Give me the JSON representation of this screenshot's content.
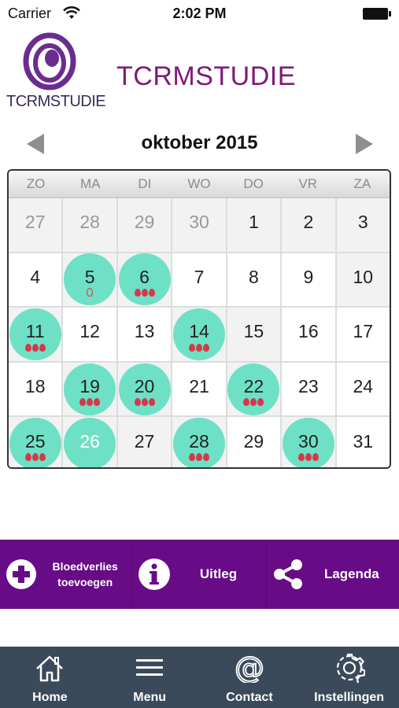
{
  "status": {
    "carrier": "Carrier",
    "time": "2:02 PM"
  },
  "header": {
    "logo_text": "TCRMSTUDIE",
    "title": "TCRMSTUDIE"
  },
  "calendar": {
    "month_label": "oktober 2015",
    "weekdays": [
      "ZO",
      "MA",
      "DI",
      "WO",
      "DO",
      "VR",
      "ZA"
    ],
    "days": [
      {
        "label": "27",
        "muted": true,
        "marked": false,
        "drops": 0
      },
      {
        "label": "28",
        "muted": true,
        "marked": false,
        "drops": 0
      },
      {
        "label": "29",
        "muted": true,
        "marked": false,
        "drops": 0
      },
      {
        "label": "30",
        "muted": true,
        "marked": false,
        "drops": 0
      },
      {
        "label": "1",
        "marked": false,
        "drops": 0
      },
      {
        "label": "2",
        "marked": false,
        "drops": 0
      },
      {
        "label": "3",
        "marked": false,
        "drops": 0
      },
      {
        "label": "4",
        "marked": false,
        "drops": 0
      },
      {
        "label": "5",
        "marked": true,
        "drops": 1,
        "drop_style": "outline"
      },
      {
        "label": "6",
        "marked": true,
        "drops": 3
      },
      {
        "label": "7",
        "marked": false,
        "drops": 0
      },
      {
        "label": "8",
        "marked": false,
        "drops": 0
      },
      {
        "label": "9",
        "marked": false,
        "drops": 0
      },
      {
        "label": "10",
        "marked": false,
        "drops": 0
      },
      {
        "label": "11",
        "marked": true,
        "drops": 3
      },
      {
        "label": "12",
        "marked": false,
        "drops": 0
      },
      {
        "label": "13",
        "marked": false,
        "drops": 0
      },
      {
        "label": "14",
        "marked": true,
        "drops": 3
      },
      {
        "label": "15",
        "marked": false,
        "drops": 0
      },
      {
        "label": "16",
        "marked": false,
        "drops": 0
      },
      {
        "label": "17",
        "marked": false,
        "drops": 0
      },
      {
        "label": "18",
        "marked": false,
        "drops": 0
      },
      {
        "label": "19",
        "marked": true,
        "drops": 3
      },
      {
        "label": "20",
        "marked": true,
        "drops": 3
      },
      {
        "label": "21",
        "marked": false,
        "drops": 0
      },
      {
        "label": "22",
        "marked": true,
        "drops": 3
      },
      {
        "label": "23",
        "marked": false,
        "drops": 0
      },
      {
        "label": "24",
        "marked": false,
        "drops": 0
      },
      {
        "label": "25",
        "marked": true,
        "drops": 3
      },
      {
        "label": "26",
        "marked": true,
        "drops": 0,
        "today": true
      },
      {
        "label": "27",
        "marked": false,
        "drops": 0
      },
      {
        "label": "28",
        "marked": true,
        "drops": 3
      },
      {
        "label": "29",
        "marked": false,
        "drops": 0
      },
      {
        "label": "30",
        "marked": true,
        "drops": 3
      },
      {
        "label": "31",
        "marked": false,
        "drops": 0
      }
    ]
  },
  "actions": {
    "add_bleeding_line1": "Bloedverlies",
    "add_bleeding_line2": "toevoegen",
    "explanation": "Uitleg",
    "legend": "Lagenda"
  },
  "tabs": {
    "home": "Home",
    "menu": "Menu",
    "contact": "Contact",
    "settings": "Instellingen"
  },
  "colors": {
    "brand_purple": "#680b86",
    "title_purple": "#7d1a7a",
    "marked_teal": "#6ee0c5",
    "drop_red": "#d6384a",
    "tabbar": "#3a4a5a"
  }
}
